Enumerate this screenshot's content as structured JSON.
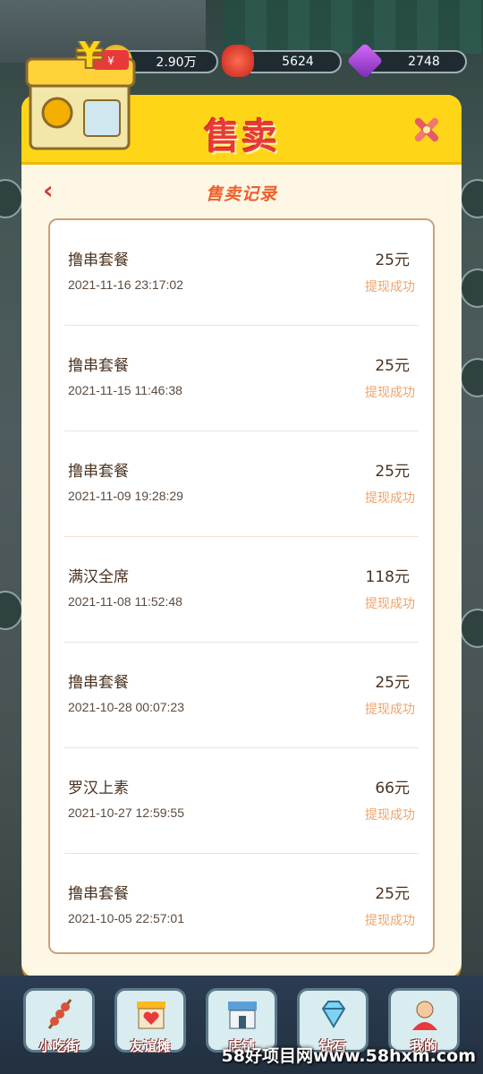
{
  "resources": [
    {
      "icon": "coin-icon",
      "value": "2.90万"
    },
    {
      "icon": "lantern-icon",
      "value": "5624"
    },
    {
      "icon": "gem-icon",
      "value": "2748"
    }
  ],
  "dialog": {
    "title": "售卖",
    "subtitle": "售卖记录",
    "back_icon": "‹"
  },
  "records": [
    {
      "name": "撸串套餐",
      "time": "2021-11-16 23:17:02",
      "amount": "25元",
      "status": "提现成功"
    },
    {
      "name": "撸串套餐",
      "time": "2021-11-15 11:46:38",
      "amount": "25元",
      "status": "提现成功"
    },
    {
      "name": "撸串套餐",
      "time": "2021-11-09 19:28:29",
      "amount": "25元",
      "status": "提现成功"
    },
    {
      "name": "满汉全席",
      "time": "2021-11-08 11:52:48",
      "amount": "118元",
      "status": "提现成功"
    },
    {
      "name": "撸串套餐",
      "time": "2021-10-28 00:07:23",
      "amount": "25元",
      "status": "提现成功"
    },
    {
      "name": "罗汉上素",
      "time": "2021-10-27 12:59:55",
      "amount": "66元",
      "status": "提现成功"
    },
    {
      "name": "撸串套餐",
      "time": "2021-10-05 22:57:01",
      "amount": "25元",
      "status": "提现成功"
    }
  ],
  "bottom_nav": [
    {
      "label": "小吃街",
      "icon": "skewer-icon"
    },
    {
      "label": "友谊摊",
      "icon": "stall-heart-icon"
    },
    {
      "label": "店铺",
      "icon": "shop-icon"
    },
    {
      "label": "钻石",
      "icon": "diamond-icon"
    },
    {
      "label": "我的",
      "icon": "profile-icon"
    }
  ],
  "watermark": "58好项目网www.58hxm.com",
  "colors": {
    "header": "#ffd617",
    "title": "#e8393b",
    "status": "#f0a36a",
    "panel": "#fff7e6"
  }
}
